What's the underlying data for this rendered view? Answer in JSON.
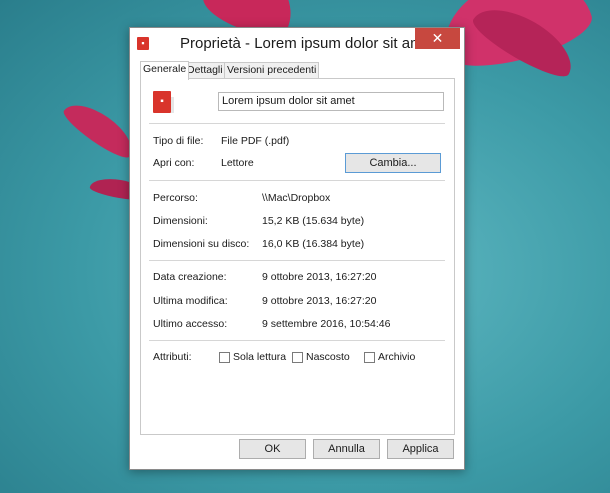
{
  "window": {
    "title": "Proprietà - Lorem ipsum dolor sit amet",
    "close_label": "✕"
  },
  "tabs": [
    "Generale",
    "Dettagli",
    "Versioni precedenti"
  ],
  "file": {
    "icon": "pdf-file-icon",
    "name": "Lorem ipsum dolor sit amet"
  },
  "type_section": {
    "file_type_label": "Tipo di file:",
    "file_type_value": "File PDF (.pdf)",
    "open_with_label": "Apri con:",
    "open_with_value": "Lettore",
    "change_button": "Cambia..."
  },
  "location_section": {
    "path_label": "Percorso:",
    "path_value": "\\\\Mac\\Dropbox",
    "size_label": "Dimensioni:",
    "size_value": "15,2 KB (15.634 byte)",
    "disk_size_label": "Dimensioni su disco:",
    "disk_size_value": "16,0 KB (16.384 byte)"
  },
  "dates_section": {
    "created_label": "Data creazione:",
    "created_value": "9 ottobre 2013, 16:27:20",
    "modified_label": "Ultima modifica:",
    "modified_value": "9 ottobre 2013, 16:27:20",
    "accessed_label": "Ultimo accesso:",
    "accessed_value": "9 settembre 2016, 10:54:46"
  },
  "attributes": {
    "label": "Attributi:",
    "read_only": "Sola lettura",
    "hidden": "Nascosto",
    "archive": "Archivio"
  },
  "footer": {
    "ok": "OK",
    "cancel": "Annulla",
    "apply": "Applica"
  }
}
